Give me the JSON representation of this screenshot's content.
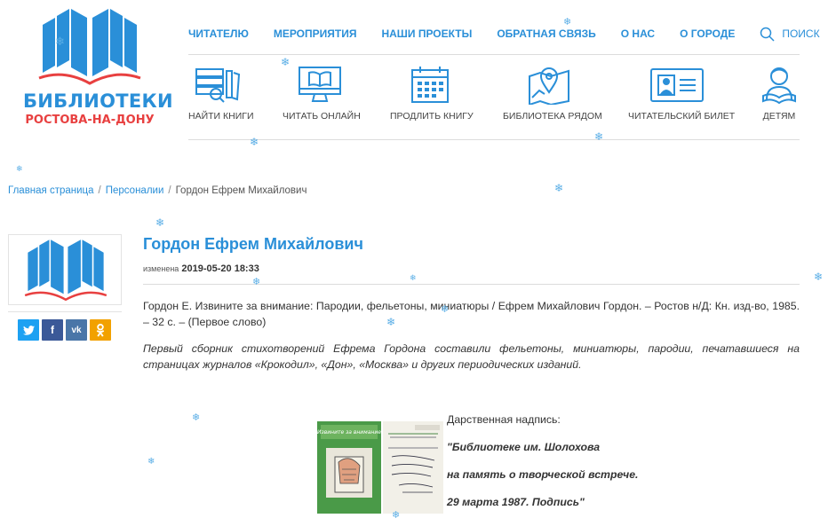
{
  "logo": {
    "line1": "БИБЛИОТЕКИ",
    "line2": "РОСТОВА-НА-ДОНУ"
  },
  "nav": {
    "items": [
      "ЧИТАТЕЛЮ",
      "МЕРОПРИЯТИЯ",
      "НАШИ ПРОЕКТЫ",
      "ОБРАТНАЯ СВЯЗЬ",
      "О НАС",
      "О ГОРОДЕ"
    ],
    "search_label": "ПОИСК"
  },
  "services": [
    {
      "label": "НАЙТИ КНИГИ",
      "icon": "books-search-icon"
    },
    {
      "label": "ЧИТАТЬ ОНЛАЙН",
      "icon": "monitor-book-icon"
    },
    {
      "label": "ПРОДЛИТЬ КНИГУ",
      "icon": "calendar-icon"
    },
    {
      "label": "БИБЛИОТЕКА РЯДОМ",
      "icon": "map-pin-icon"
    },
    {
      "label": "ЧИТАТЕЛЬСКИЙ БИЛЕТ",
      "icon": "id-card-icon"
    },
    {
      "label": "ДЕТЯМ",
      "icon": "child-reading-icon"
    }
  ],
  "breadcrumb": {
    "home": "Главная страница",
    "section": "Персоналии",
    "current": "Гордон Ефрем Михайлович"
  },
  "share": {
    "twitter": "twitter",
    "facebook": "f",
    "vk": "vk",
    "ok": "ok"
  },
  "article": {
    "title": "Гордон Ефрем Михайлович",
    "modified_label": "изменена",
    "modified_date": "2019-05-20 18:33",
    "citation": "Гордон Е.  Извините за внимание: Пародии, фельетоны, миниатюры / Ефрем Михайлович Гордон. – Ростов н/Д: Кн. изд-во, 1985. – 32 с. – (Первое слово)",
    "description": "Первый сборник стихотворений Ефрема Гордона составили фельетоны, миниатюры, пародии, печатавшиеся на страницах журналов «Крокодил», «Дон», «Москва» и других периодических изданий.",
    "inscription": {
      "label": "Дарственная надпись:",
      "line1": "\"Библиотеке им. Шолохова",
      "line2": "на память о творческой встрече.",
      "line3": "29 марта 1987. Подпись\""
    },
    "cover_title": "Извините за внимание"
  },
  "colors": {
    "brand_blue": "#2a8fd8",
    "brand_red": "#e84040",
    "twitter": "#1da1f2",
    "facebook": "#3b5998",
    "vk": "#4a76a8",
    "ok": "#f2a100"
  }
}
